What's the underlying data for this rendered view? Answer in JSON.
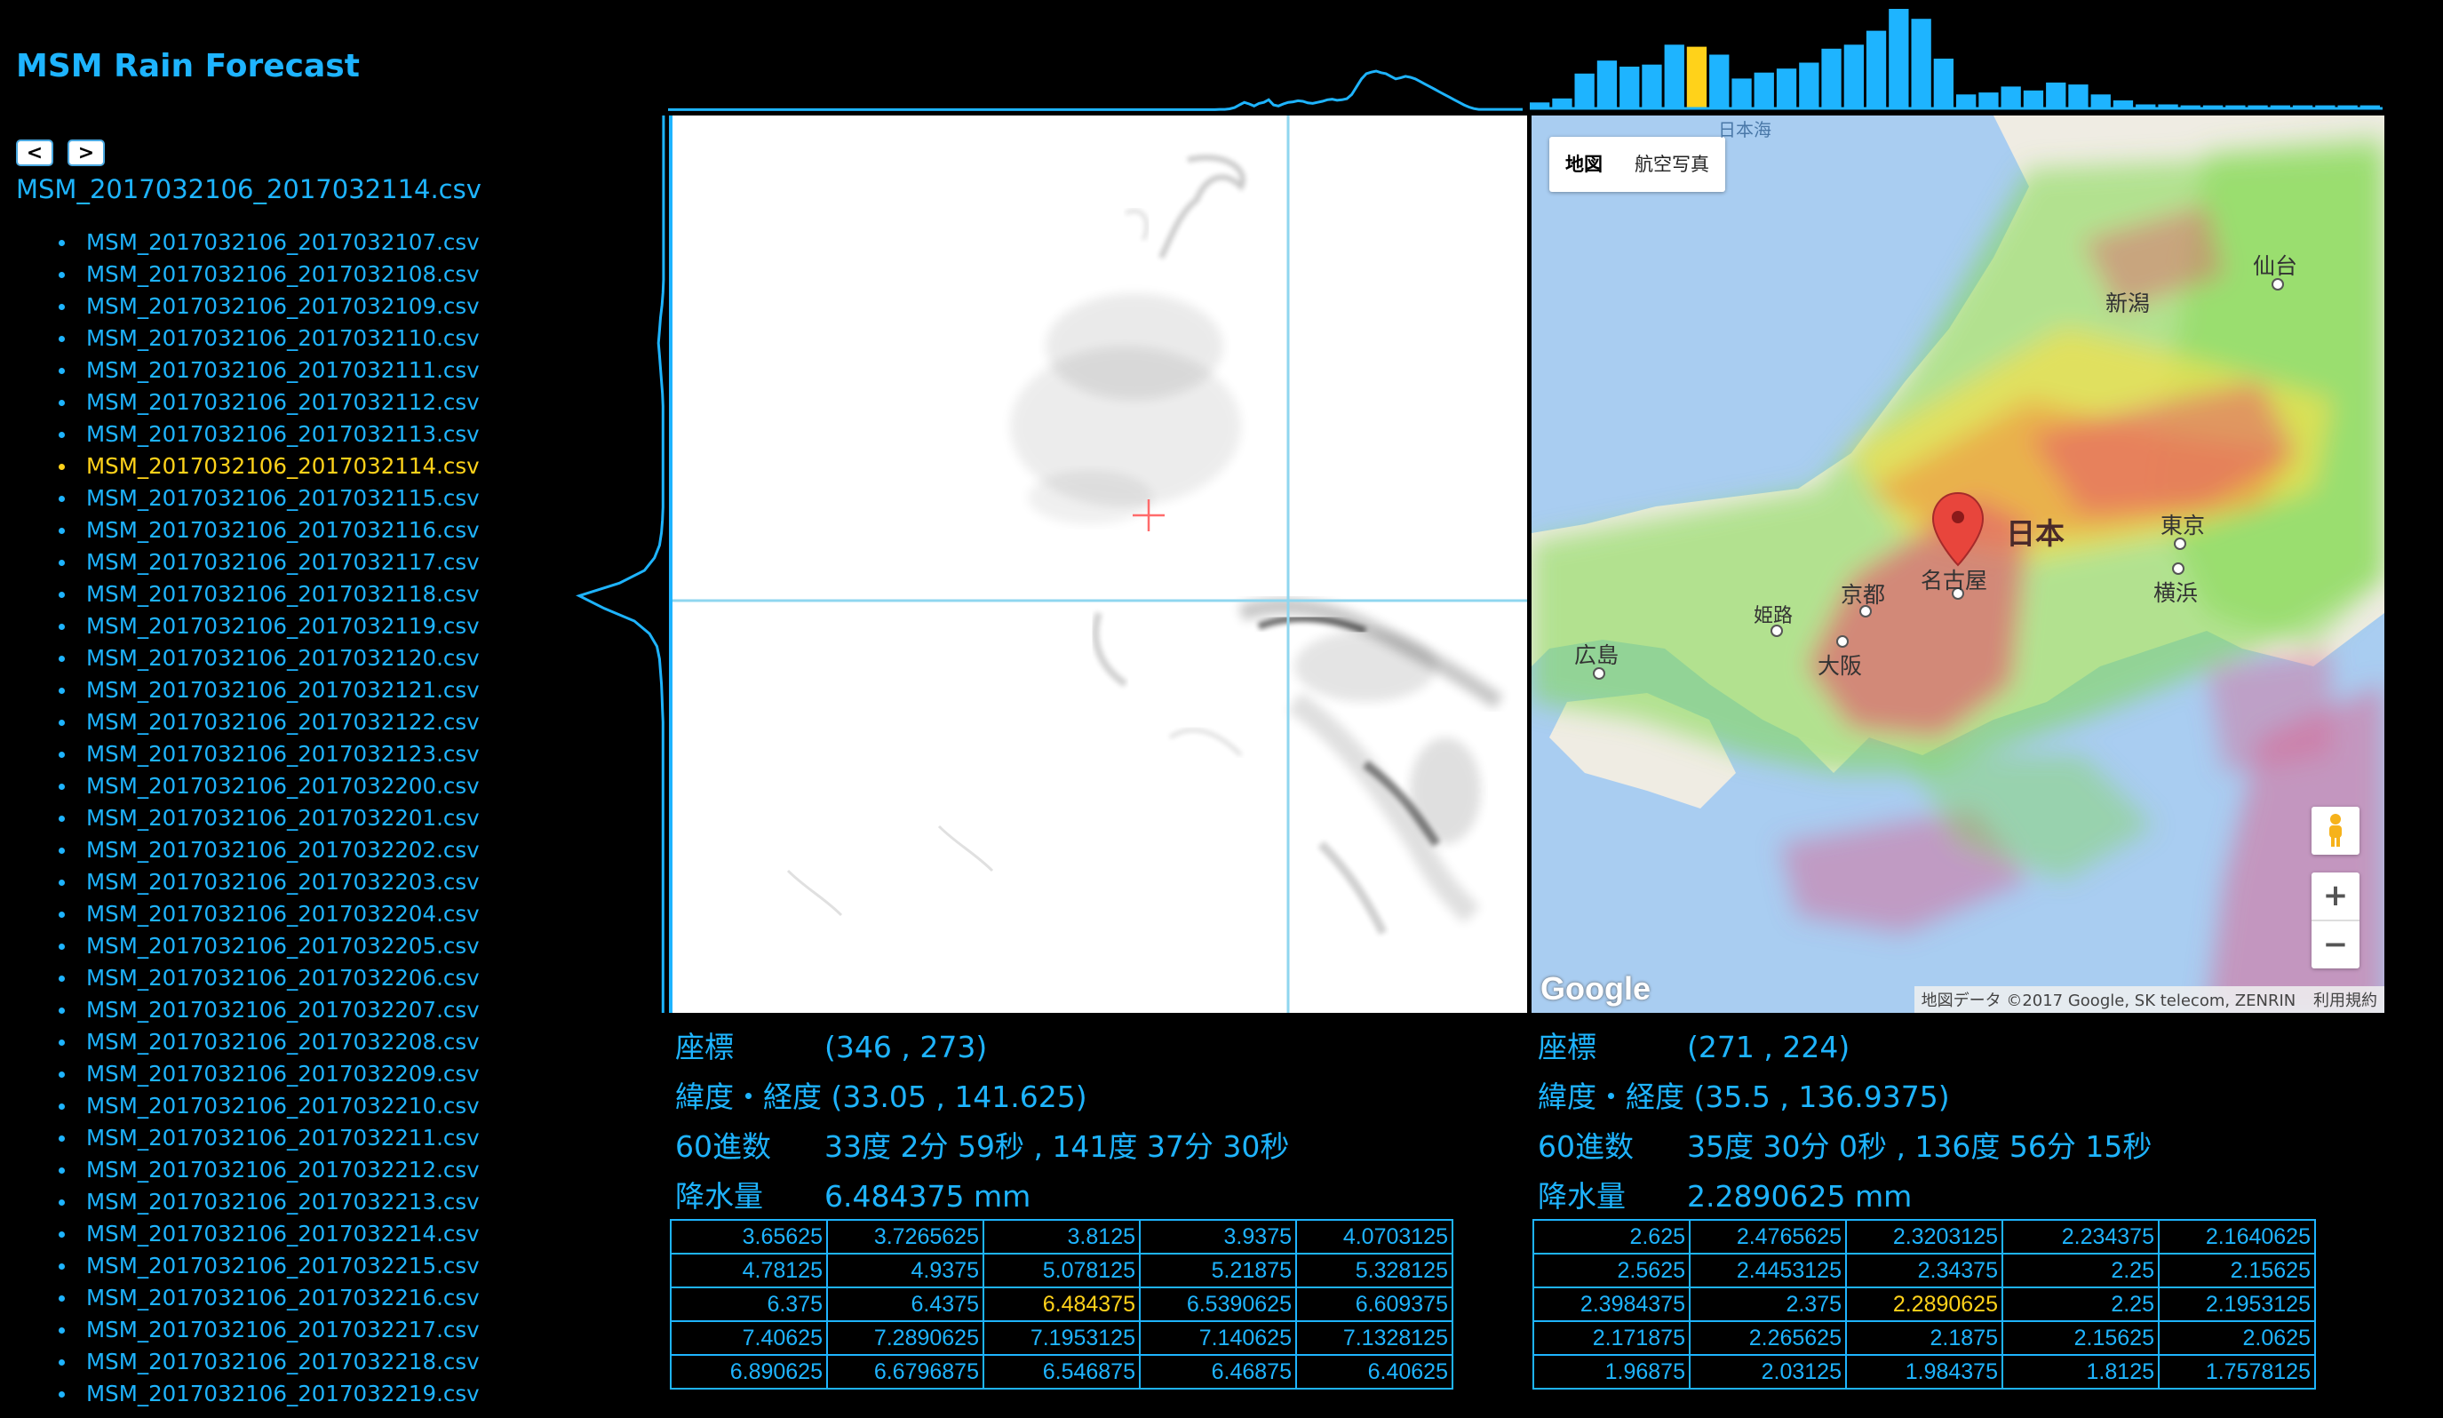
{
  "app": {
    "title": "MSM Rain Forecast"
  },
  "nav": {
    "prev_label": "<",
    "next_label": ">"
  },
  "current_file": "MSM_2017032106_2017032114.csv",
  "files": [
    "MSM_2017032106_2017032107.csv",
    "MSM_2017032106_2017032108.csv",
    "MSM_2017032106_2017032109.csv",
    "MSM_2017032106_2017032110.csv",
    "MSM_2017032106_2017032111.csv",
    "MSM_2017032106_2017032112.csv",
    "MSM_2017032106_2017032113.csv",
    "MSM_2017032106_2017032114.csv",
    "MSM_2017032106_2017032115.csv",
    "MSM_2017032106_2017032116.csv",
    "MSM_2017032106_2017032117.csv",
    "MSM_2017032106_2017032118.csv",
    "MSM_2017032106_2017032119.csv",
    "MSM_2017032106_2017032120.csv",
    "MSM_2017032106_2017032121.csv",
    "MSM_2017032106_2017032122.csv",
    "MSM_2017032106_2017032123.csv",
    "MSM_2017032106_2017032200.csv",
    "MSM_2017032106_2017032201.csv",
    "MSM_2017032106_2017032202.csv",
    "MSM_2017032106_2017032203.csv",
    "MSM_2017032106_2017032204.csv",
    "MSM_2017032106_2017032205.csv",
    "MSM_2017032106_2017032206.csv",
    "MSM_2017032106_2017032207.csv",
    "MSM_2017032106_2017032208.csv",
    "MSM_2017032106_2017032209.csv",
    "MSM_2017032106_2017032210.csv",
    "MSM_2017032106_2017032211.csv",
    "MSM_2017032106_2017032212.csv",
    "MSM_2017032106_2017032213.csv",
    "MSM_2017032106_2017032214.csv",
    "MSM_2017032106_2017032215.csv",
    "MSM_2017032106_2017032216.csv",
    "MSM_2017032106_2017032217.csv",
    "MSM_2017032106_2017032218.csv",
    "MSM_2017032106_2017032219.csv"
  ],
  "active_file_index": 7,
  "histogram": {
    "values": [
      6,
      10,
      35,
      48,
      42,
      44,
      64,
      62,
      54,
      30,
      36,
      40,
      46,
      60,
      64,
      78,
      100,
      90,
      50,
      14,
      16,
      22,
      18,
      26,
      24,
      14,
      8,
      4,
      4,
      3,
      3,
      3,
      3,
      3,
      3,
      3,
      3,
      3
    ],
    "highlight_index": 7
  },
  "top_profile": [
    0.2,
    0.2,
    0.2,
    0.2,
    0.2,
    0.2,
    0.2,
    0.2,
    0.2,
    0.2,
    0.2,
    0.2,
    0.2,
    0.2,
    0.2,
    0.2,
    0.2,
    0.2,
    0.2,
    0.2,
    0.2,
    0.2,
    0.2,
    0.2,
    0.2,
    0.2,
    0.2,
    0.2,
    0.2,
    0.2,
    0.2,
    0.2,
    0.2,
    0.2,
    0.2,
    0.2,
    0.2,
    0.2,
    0.2,
    0.2,
    0.2,
    0.2,
    0.2,
    0.2,
    0.2,
    0.2,
    0.2,
    0.2,
    0.2,
    0.2,
    0.2,
    0.2,
    0.2,
    0.2,
    0.2,
    0.2,
    0.2,
    0.2,
    0.2,
    0.2,
    0.2,
    0.2,
    0.2,
    0.2,
    0.2,
    0.2,
    0.2,
    0.2,
    0.2,
    0.2,
    0.2,
    0.2,
    0.2,
    0.2,
    0.2,
    0.2,
    0.2,
    0.2,
    0.2,
    0.2,
    0.2,
    0.2,
    0.2,
    0.2,
    0.2,
    0.2,
    0.2,
    0.2,
    0.2,
    0.2,
    0.2,
    0.2,
    0.2,
    0.2,
    0.2,
    0.2,
    0.2,
    0.2,
    0.2,
    0.2,
    0.2,
    0.2,
    0.2,
    0.2,
    0.2,
    0.2,
    0.2,
    0.2,
    0.2,
    0.2,
    0.2,
    0.2,
    0.2,
    0.3,
    0.3,
    0.5,
    1,
    2,
    3,
    2.4,
    1.6,
    2.6,
    3,
    4,
    2,
    1.6,
    2.4,
    3,
    3.2,
    3.6,
    3.4,
    2.8,
    2.6,
    3,
    3.4,
    4,
    4.2,
    3.8,
    4,
    4.4,
    6,
    9,
    12,
    14,
    14.6,
    15,
    14.4,
    14,
    13,
    12,
    12.4,
    13,
    12.6,
    12,
    11,
    10,
    9,
    8,
    7,
    6,
    5,
    4,
    3,
    2,
    1.2,
    0.6,
    0.3,
    0.3,
    0.3,
    0.3,
    0.3,
    0.3,
    0.3,
    0.3,
    0.3,
    0.3
  ],
  "left_profile": [
    0.2,
    0.2,
    0.2,
    0.2,
    0.2,
    0.2,
    0.2,
    0.2,
    0.2,
    0.2,
    0.2,
    0.2,
    0.2,
    0.2,
    0.3,
    0.5,
    0.8,
    1,
    1.2,
    1,
    0.8,
    0.6,
    0.4,
    0.3,
    0.3,
    0.3,
    0.3,
    0.3,
    0.3,
    0.3,
    0.3,
    0.3,
    0.4,
    0.6,
    1,
    2,
    4,
    9,
    17,
    12,
    6,
    3,
    1.5,
    1,
    0.8,
    0.6,
    0.5,
    0.4,
    0.3,
    0.3,
    0.3,
    0.3,
    0.3,
    0.3,
    0.3,
    0.3,
    0.3,
    0.3,
    0.3,
    0.3,
    0.3,
    0.3,
    0.3,
    0.3,
    0.3,
    0.3,
    0.3,
    0.3,
    0.3,
    0.3,
    0.3,
    0.3
  ],
  "left_panel": {
    "labels": {
      "coord": "座標",
      "latlon": "緯度・経度",
      "sexagesimal": "60進数",
      "rain": "降水量"
    },
    "coord": "(346 , 273)",
    "latlon": "(33.05 , 141.625)",
    "sexagesimal": "33度 2分 59秒 , 141度 37分 30秒",
    "rain": "6.484375 mm",
    "grid": [
      [
        "3.65625",
        "3.7265625",
        "3.8125",
        "3.9375",
        "4.0703125"
      ],
      [
        "4.78125",
        "4.9375",
        "5.078125",
        "5.21875",
        "5.328125"
      ],
      [
        "6.375",
        "6.4375",
        "6.484375",
        "6.5390625",
        "6.609375"
      ],
      [
        "7.40625",
        "7.2890625",
        "7.1953125",
        "7.140625",
        "7.1328125"
      ],
      [
        "6.890625",
        "6.6796875",
        "6.546875",
        "6.46875",
        "6.40625"
      ]
    ]
  },
  "right_panel": {
    "labels": {
      "coord": "座標",
      "latlon": "緯度・経度",
      "sexagesimal": "60進数",
      "rain": "降水量"
    },
    "coord": "(271 , 224)",
    "latlon": "(35.5 , 136.9375)",
    "sexagesimal": "35度 30分 0秒 , 136度 56分 15秒",
    "rain": "2.2890625 mm",
    "grid": [
      [
        "2.625",
        "2.4765625",
        "2.3203125",
        "2.234375",
        "2.1640625"
      ],
      [
        "2.5625",
        "2.4453125",
        "2.34375",
        "2.25",
        "2.15625"
      ],
      [
        "2.3984375",
        "2.375",
        "2.2890625",
        "2.25",
        "2.1953125"
      ],
      [
        "2.171875",
        "2.265625",
        "2.1875",
        "2.15625",
        "2.0625"
      ],
      [
        "1.96875",
        "2.03125",
        "1.984375",
        "1.8125",
        "1.7578125"
      ]
    ]
  },
  "map": {
    "type_map": "地図",
    "type_satellite": "航空写真",
    "sea_label": "日本海",
    "country_label": "日本",
    "cities": {
      "sendai": "仙台",
      "niigata": "新潟",
      "tokyo": "東京",
      "yokohama": "横浜",
      "nagoya": "名古屋",
      "kyoto": "京都",
      "osaka": "大阪",
      "himeji": "姫路",
      "hiroshima": "広島"
    },
    "logo": "Google",
    "attribution": "地図データ ©2017 Google, SK telecom, ZENRIN",
    "terms": "利用規約",
    "zoom_in": "+",
    "zoom_out": "−"
  },
  "colors": {
    "accent": "#1eb4ff",
    "highlight": "#ffd21a",
    "background": "#000000"
  }
}
